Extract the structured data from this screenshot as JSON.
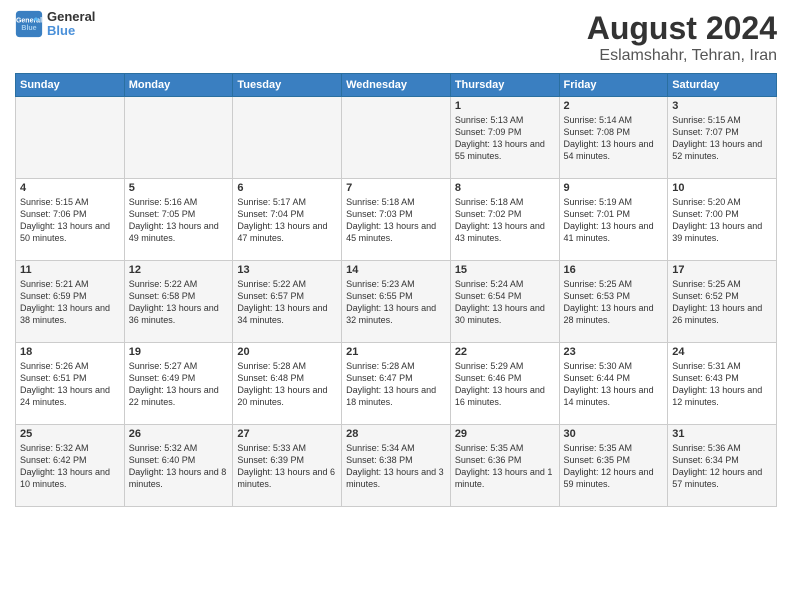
{
  "header": {
    "logo": {
      "line1": "General",
      "line2": "Blue"
    },
    "title": "August 2024",
    "subtitle": "Eslamshahr, Tehran, Iran"
  },
  "weekdays": [
    "Sunday",
    "Monday",
    "Tuesday",
    "Wednesday",
    "Thursday",
    "Friday",
    "Saturday"
  ],
  "weeks": [
    [
      {
        "num": "",
        "info": ""
      },
      {
        "num": "",
        "info": ""
      },
      {
        "num": "",
        "info": ""
      },
      {
        "num": "",
        "info": ""
      },
      {
        "num": "1",
        "info": "Sunrise: 5:13 AM\nSunset: 7:09 PM\nDaylight: 13 hours\nand 55 minutes."
      },
      {
        "num": "2",
        "info": "Sunrise: 5:14 AM\nSunset: 7:08 PM\nDaylight: 13 hours\nand 54 minutes."
      },
      {
        "num": "3",
        "info": "Sunrise: 5:15 AM\nSunset: 7:07 PM\nDaylight: 13 hours\nand 52 minutes."
      }
    ],
    [
      {
        "num": "4",
        "info": "Sunrise: 5:15 AM\nSunset: 7:06 PM\nDaylight: 13 hours\nand 50 minutes."
      },
      {
        "num": "5",
        "info": "Sunrise: 5:16 AM\nSunset: 7:05 PM\nDaylight: 13 hours\nand 49 minutes."
      },
      {
        "num": "6",
        "info": "Sunrise: 5:17 AM\nSunset: 7:04 PM\nDaylight: 13 hours\nand 47 minutes."
      },
      {
        "num": "7",
        "info": "Sunrise: 5:18 AM\nSunset: 7:03 PM\nDaylight: 13 hours\nand 45 minutes."
      },
      {
        "num": "8",
        "info": "Sunrise: 5:18 AM\nSunset: 7:02 PM\nDaylight: 13 hours\nand 43 minutes."
      },
      {
        "num": "9",
        "info": "Sunrise: 5:19 AM\nSunset: 7:01 PM\nDaylight: 13 hours\nand 41 minutes."
      },
      {
        "num": "10",
        "info": "Sunrise: 5:20 AM\nSunset: 7:00 PM\nDaylight: 13 hours\nand 39 minutes."
      }
    ],
    [
      {
        "num": "11",
        "info": "Sunrise: 5:21 AM\nSunset: 6:59 PM\nDaylight: 13 hours\nand 38 minutes."
      },
      {
        "num": "12",
        "info": "Sunrise: 5:22 AM\nSunset: 6:58 PM\nDaylight: 13 hours\nand 36 minutes."
      },
      {
        "num": "13",
        "info": "Sunrise: 5:22 AM\nSunset: 6:57 PM\nDaylight: 13 hours\nand 34 minutes."
      },
      {
        "num": "14",
        "info": "Sunrise: 5:23 AM\nSunset: 6:55 PM\nDaylight: 13 hours\nand 32 minutes."
      },
      {
        "num": "15",
        "info": "Sunrise: 5:24 AM\nSunset: 6:54 PM\nDaylight: 13 hours\nand 30 minutes."
      },
      {
        "num": "16",
        "info": "Sunrise: 5:25 AM\nSunset: 6:53 PM\nDaylight: 13 hours\nand 28 minutes."
      },
      {
        "num": "17",
        "info": "Sunrise: 5:25 AM\nSunset: 6:52 PM\nDaylight: 13 hours\nand 26 minutes."
      }
    ],
    [
      {
        "num": "18",
        "info": "Sunrise: 5:26 AM\nSunset: 6:51 PM\nDaylight: 13 hours\nand 24 minutes."
      },
      {
        "num": "19",
        "info": "Sunrise: 5:27 AM\nSunset: 6:49 PM\nDaylight: 13 hours\nand 22 minutes."
      },
      {
        "num": "20",
        "info": "Sunrise: 5:28 AM\nSunset: 6:48 PM\nDaylight: 13 hours\nand 20 minutes."
      },
      {
        "num": "21",
        "info": "Sunrise: 5:28 AM\nSunset: 6:47 PM\nDaylight: 13 hours\nand 18 minutes."
      },
      {
        "num": "22",
        "info": "Sunrise: 5:29 AM\nSunset: 6:46 PM\nDaylight: 13 hours\nand 16 minutes."
      },
      {
        "num": "23",
        "info": "Sunrise: 5:30 AM\nSunset: 6:44 PM\nDaylight: 13 hours\nand 14 minutes."
      },
      {
        "num": "24",
        "info": "Sunrise: 5:31 AM\nSunset: 6:43 PM\nDaylight: 13 hours\nand 12 minutes."
      }
    ],
    [
      {
        "num": "25",
        "info": "Sunrise: 5:32 AM\nSunset: 6:42 PM\nDaylight: 13 hours\nand 10 minutes."
      },
      {
        "num": "26",
        "info": "Sunrise: 5:32 AM\nSunset: 6:40 PM\nDaylight: 13 hours\nand 8 minutes."
      },
      {
        "num": "27",
        "info": "Sunrise: 5:33 AM\nSunset: 6:39 PM\nDaylight: 13 hours\nand 6 minutes."
      },
      {
        "num": "28",
        "info": "Sunrise: 5:34 AM\nSunset: 6:38 PM\nDaylight: 13 hours\nand 3 minutes."
      },
      {
        "num": "29",
        "info": "Sunrise: 5:35 AM\nSunset: 6:36 PM\nDaylight: 13 hours\nand 1 minute."
      },
      {
        "num": "30",
        "info": "Sunrise: 5:35 AM\nSunset: 6:35 PM\nDaylight: 12 hours\nand 59 minutes."
      },
      {
        "num": "31",
        "info": "Sunrise: 5:36 AM\nSunset: 6:34 PM\nDaylight: 12 hours\nand 57 minutes."
      }
    ]
  ]
}
